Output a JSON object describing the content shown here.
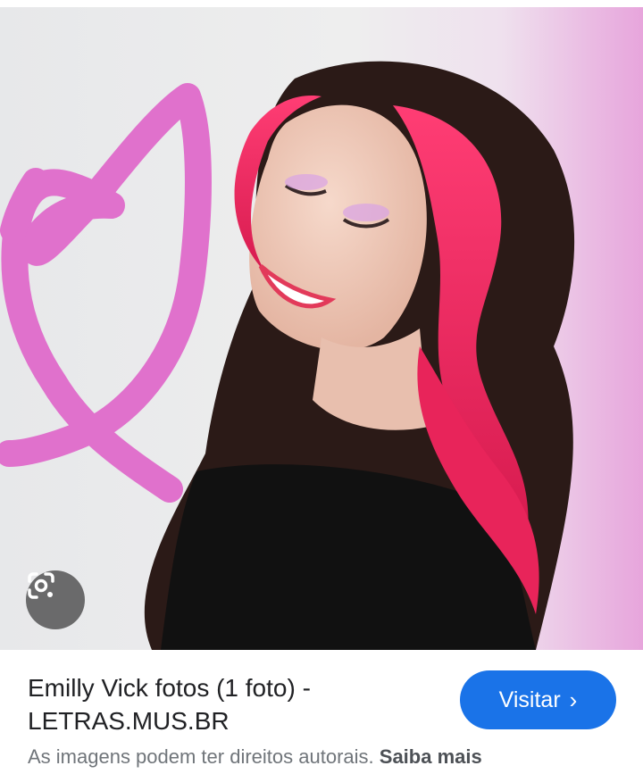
{
  "image": {
    "alt": "",
    "lens_icon": "google-lens-icon",
    "colors": {
      "hair_pink": "#f0255a",
      "hair_dark": "#2b1a17",
      "marker_pink": "#e071cc",
      "background": "#ececec"
    }
  },
  "result": {
    "title": "Emilly Vick fotos (1 foto) - LETRAS.MUS.BR",
    "visit_label": "Visitar",
    "visit_icon": "chevron-right-icon",
    "visit_color": "#1a73e8",
    "copyright_notice": "As imagens podem ter direitos autorais.",
    "learn_more_label": "Saiba mais"
  }
}
